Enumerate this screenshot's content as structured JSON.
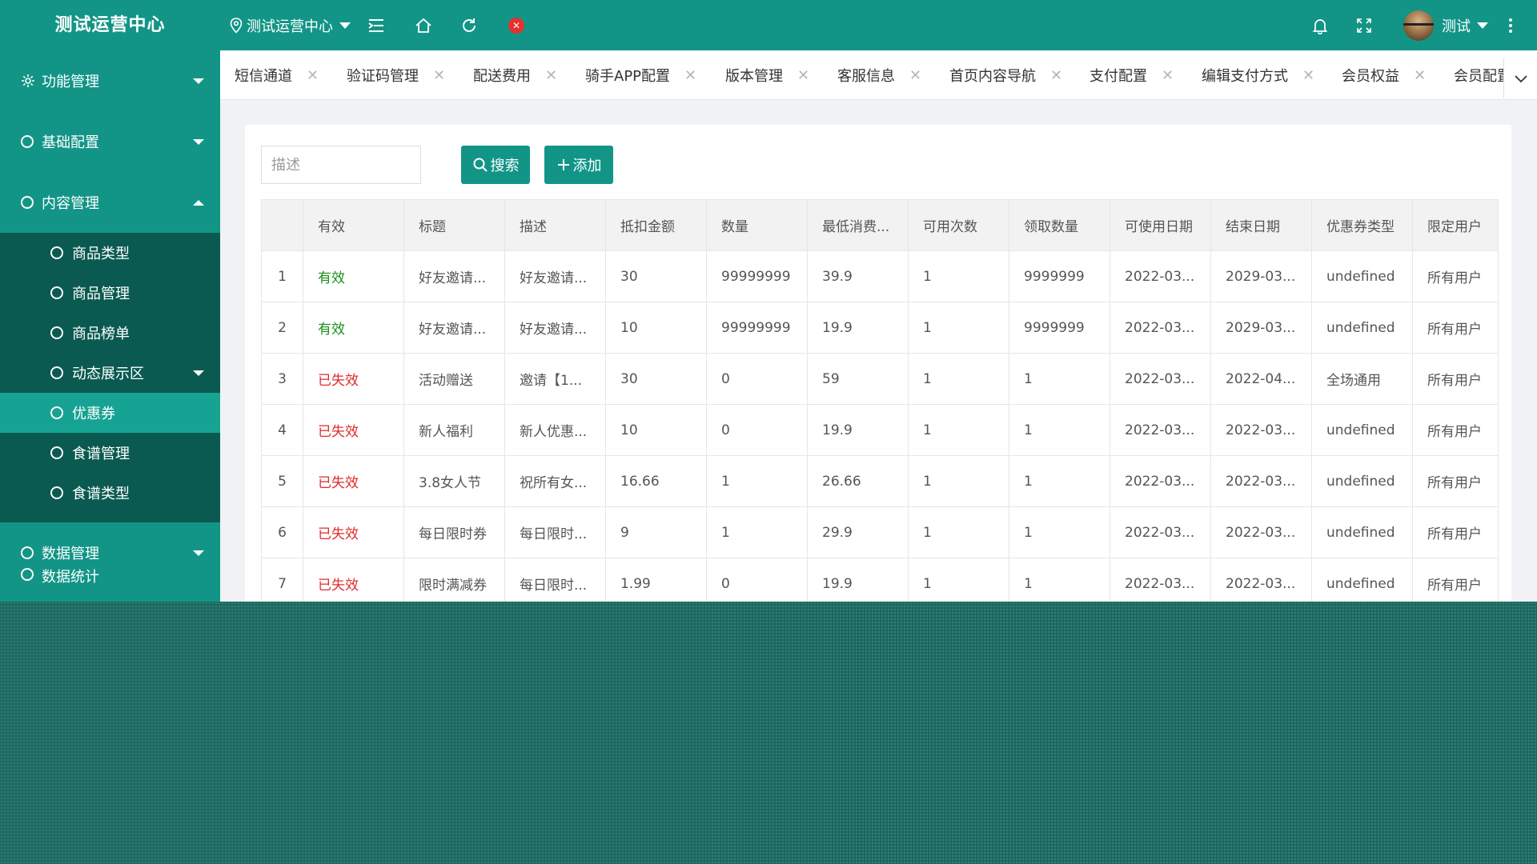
{
  "header": {
    "app_title": "测试运营中心",
    "location": "测试运营中心",
    "username": "测试"
  },
  "sidebar": {
    "groups": [
      {
        "label": "功能管理"
      },
      {
        "label": "基础配置"
      },
      {
        "label": "内容管理"
      },
      {
        "label": "数据管理"
      },
      {
        "label": "数据统计"
      }
    ],
    "sub_items": [
      {
        "label": "商品类型"
      },
      {
        "label": "商品管理"
      },
      {
        "label": "商品榜单"
      },
      {
        "label": "动态展示区"
      },
      {
        "label": "优惠券"
      },
      {
        "label": "食谱管理"
      },
      {
        "label": "食谱类型"
      }
    ]
  },
  "tabs": [
    {
      "label": "短信通道"
    },
    {
      "label": "验证码管理"
    },
    {
      "label": "配送费用"
    },
    {
      "label": "骑手APP配置"
    },
    {
      "label": "版本管理"
    },
    {
      "label": "客服信息"
    },
    {
      "label": "首页内容导航"
    },
    {
      "label": "支付配置"
    },
    {
      "label": "编辑支付方式"
    },
    {
      "label": "会员权益"
    },
    {
      "label": "会员配置"
    }
  ],
  "toolbar": {
    "search_placeholder": "描述",
    "search_label": "搜索",
    "add_label": "添加"
  },
  "table": {
    "columns": [
      "",
      "有效",
      "标题",
      "描述",
      "抵扣金额",
      "数量",
      "最低消费...",
      "可用次数",
      "领取数量",
      "可使用日期",
      "结束日期",
      "优惠券类型",
      "限定用户"
    ],
    "rows": [
      [
        "1",
        "有效",
        "好友邀请...",
        "好友邀请...",
        "30",
        "99999999",
        "39.9",
        "1",
        "9999999",
        "2022-03...",
        "2029-03...",
        "undefined",
        "所有用户"
      ],
      [
        "2",
        "有效",
        "好友邀请...",
        "好友邀请...",
        "10",
        "99999999",
        "19.9",
        "1",
        "9999999",
        "2022-03...",
        "2029-03...",
        "undefined",
        "所有用户"
      ],
      [
        "3",
        "已失效",
        "活动赠送",
        "邀请【1...",
        "30",
        "0",
        "59",
        "1",
        "1",
        "2022-03...",
        "2022-04...",
        "全场通用",
        "所有用户"
      ],
      [
        "4",
        "已失效",
        "新人福利",
        "新人优惠...",
        "10",
        "0",
        "19.9",
        "1",
        "1",
        "2022-03...",
        "2022-03...",
        "undefined",
        "所有用户"
      ],
      [
        "5",
        "已失效",
        "3.8女人节",
        "祝所有女...",
        "16.66",
        "1",
        "26.66",
        "1",
        "1",
        "2022-03...",
        "2022-03...",
        "undefined",
        "所有用户"
      ],
      [
        "6",
        "已失效",
        "每日限时券",
        "每日限时...",
        "9",
        "1",
        "29.9",
        "1",
        "1",
        "2022-03...",
        "2022-03...",
        "undefined",
        "所有用户"
      ],
      [
        "7",
        "已失效",
        "限时满减券",
        "每日限时...",
        "1.99",
        "0",
        "19.9",
        "1",
        "1",
        "2022-03...",
        "2022-03...",
        "undefined",
        "所有用户"
      ]
    ]
  },
  "colors": {
    "primary": "#129587",
    "sidebar_sub_bg": "#0b5a51",
    "valid": "#1a8f1a",
    "invalid": "#e02b2b"
  }
}
